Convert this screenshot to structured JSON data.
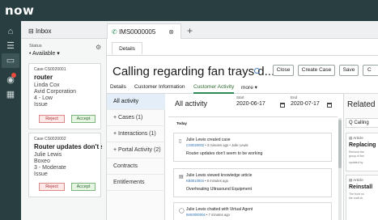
{
  "app": {
    "logo_text": "now"
  },
  "workspace_tabs": {
    "inbox_label": "Inbox",
    "case_label": "IMS0000005",
    "close_glyph": "⊗",
    "add_glyph": "+"
  },
  "inbox": {
    "status_label": "Status",
    "status_value": "• Available ▾",
    "cards": [
      {
        "number": "Case CS0020001",
        "title": "router",
        "lines": [
          "Linda Cox",
          "Avid Corporation",
          "4 - Low",
          "Issue"
        ],
        "reject": "Reject",
        "accept": "Accept"
      },
      {
        "number": "Case CS0020002",
        "title": "Router updates don't s...",
        "lines": [
          "Julie Lewis",
          "Boxeo",
          "3 - Moderate",
          "Issue"
        ],
        "reject": "Reject",
        "accept": "Accept"
      }
    ]
  },
  "main": {
    "details_tab": "Details",
    "title": "Calling regarding fan trays d...",
    "buttons": {
      "close": "Close",
      "create_case": "Create Case",
      "save": "Save",
      "more": "C"
    },
    "sub_tabs": [
      "Details",
      "Customer Information",
      "Customer Activity",
      "more ▾"
    ],
    "nav": [
      "All activity",
      "+ Cases (1)",
      "+ Interactions (1)",
      "+ Portal Activity (2)",
      "Contracts",
      "Entitlements"
    ],
    "activity": {
      "title": "All activity",
      "start_label": "Start",
      "start_value": "2020-06-17",
      "end_label": "End",
      "end_value": "2020-07-17",
      "day_label": "Today",
      "entries": [
        {
          "icon": "case-icon",
          "head": "Julie Lewis created case",
          "num": "CS0020002",
          "meta": " • 3 minutes ago • Julie Lewis",
          "body": "Router updates don't seem to be working"
        },
        {
          "icon": "article-icon",
          "head": "Julie Lewis viewed knowledge article",
          "num": "KB0010004",
          "meta": " • 8 minutes ago",
          "body": "Overheating Ultrasound Equipment"
        },
        {
          "icon": "chat-icon",
          "head": "Julie Lewis chatted with Virtual Agent",
          "num": "IMS0000004",
          "meta": " • 7 minutes ago",
          "body": ""
        }
      ]
    },
    "related": {
      "title": "Related",
      "search": "Q Calling",
      "cards": [
        {
          "kind": "Article",
          "title": "Replacing",
          "summary": [
            "Remove the",
            "group of fan"
          ],
          "footer": "updated by"
        },
        {
          "kind": "Article",
          "title": "Reinstall",
          "summary": [
            "The front no",
            "the craft ch"
          ],
          "footer": ""
        }
      ]
    }
  }
}
